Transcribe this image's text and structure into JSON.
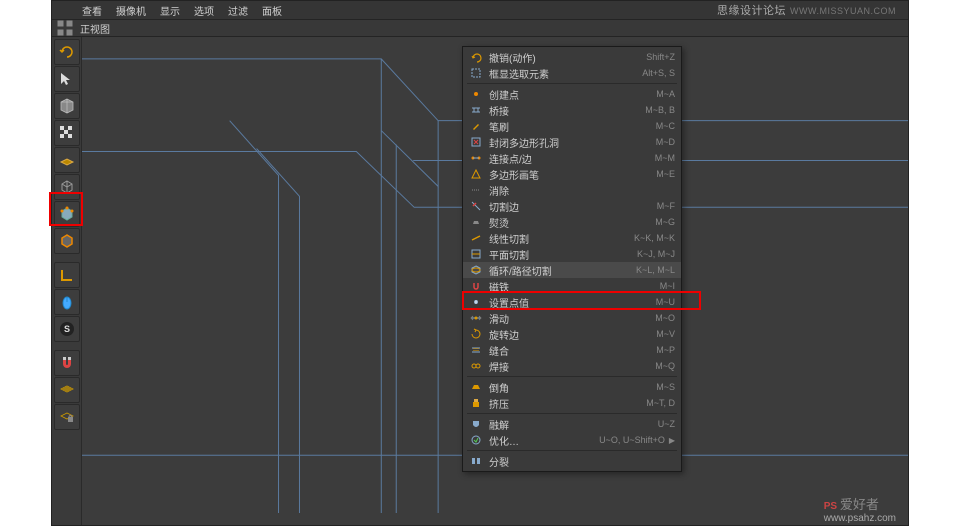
{
  "menubar": {
    "items": [
      "查看",
      "摄像机",
      "显示",
      "选项",
      "过滤",
      "面板"
    ]
  },
  "subbar": {
    "label": "正视图"
  },
  "toolbar": {
    "tools": [
      {
        "name": "undo-icon",
        "svg": "undo"
      },
      {
        "name": "live-select-icon",
        "svg": "cursor"
      },
      {
        "name": "move-icon",
        "svg": "cube"
      },
      {
        "name": "checker-icon",
        "svg": "checker"
      },
      {
        "name": "floor-icon",
        "svg": "floor"
      },
      {
        "name": "model-mode-icon",
        "svg": "cubewire"
      },
      {
        "name": "point-mode-icon",
        "svg": "cubepoint",
        "highlight": true
      },
      {
        "name": "edge-mode-icon",
        "svg": "cubeedge"
      },
      {
        "name": "axis-icon",
        "svg": "lcorner"
      },
      {
        "name": "mouse-icon",
        "svg": "mouse"
      },
      {
        "name": "snap-s-icon",
        "svg": "s"
      },
      {
        "name": "magnet-icon",
        "svg": "magnet"
      },
      {
        "name": "workplane-icon",
        "svg": "grid"
      },
      {
        "name": "locked-workplane-icon",
        "svg": "gridlock"
      }
    ]
  },
  "context_menu": {
    "groups": [
      [
        {
          "label": "撤销(动作)",
          "short": "Shift+Z",
          "icon": "undo"
        },
        {
          "label": "框显选取元素",
          "short": "Alt+S, S",
          "icon": "frame"
        }
      ],
      [
        {
          "label": "创建点",
          "short": "M~A",
          "icon": "point"
        },
        {
          "label": "桥接",
          "short": "M~B, B",
          "icon": "bridge"
        },
        {
          "label": "笔刷",
          "short": "M~C",
          "icon": "brush"
        },
        {
          "label": "封闭多边形孔洞",
          "short": "M~D",
          "icon": "close"
        },
        {
          "label": "连接点/边",
          "short": "M~M",
          "icon": "connect"
        },
        {
          "label": "多边形画笔",
          "short": "M~E",
          "icon": "polypen"
        },
        {
          "label": "消除",
          "short": "",
          "icon": "dissolve"
        },
        {
          "label": "切割边",
          "short": "M~F",
          "icon": "cutedge"
        },
        {
          "label": "熨烫",
          "short": "M~G",
          "icon": "iron"
        },
        {
          "label": "线性切割",
          "short": "K~K, M~K",
          "icon": "linecut"
        },
        {
          "label": "平面切割",
          "short": "K~J, M~J",
          "icon": "planecut"
        },
        {
          "label": "循环/路径切割",
          "short": "K~L, M~L",
          "icon": "loopcut",
          "highlight": true
        },
        {
          "label": "磁铁",
          "short": "M~I",
          "icon": "magnet"
        },
        {
          "label": "设置点值",
          "short": "M~U",
          "icon": "setval"
        },
        {
          "label": "滑动",
          "short": "M~O",
          "icon": "slide"
        },
        {
          "label": "旋转边",
          "short": "M~V",
          "icon": "spinedge"
        },
        {
          "label": "缝合",
          "short": "M~P",
          "icon": "stitch"
        },
        {
          "label": "焊接",
          "short": "M~Q",
          "icon": "weld"
        }
      ],
      [
        {
          "label": "倒角",
          "short": "M~S",
          "icon": "bevel"
        },
        {
          "label": "挤压",
          "short": "M~T, D",
          "icon": "extrude"
        }
      ],
      [
        {
          "label": "融解",
          "short": "U~Z",
          "icon": "melt"
        },
        {
          "label": "优化…",
          "short": "U~O, U~Shift+O",
          "icon": "optimize",
          "arrow": true
        }
      ],
      [
        {
          "label": "分裂",
          "short": "",
          "icon": "split"
        }
      ]
    ]
  },
  "watermark": {
    "tr_text": "思缘设计论坛",
    "tr_domain": "WWW.MISSYUAN.COM",
    "br_cn": "爱好者",
    "br_domain": "www.psahz.com"
  }
}
